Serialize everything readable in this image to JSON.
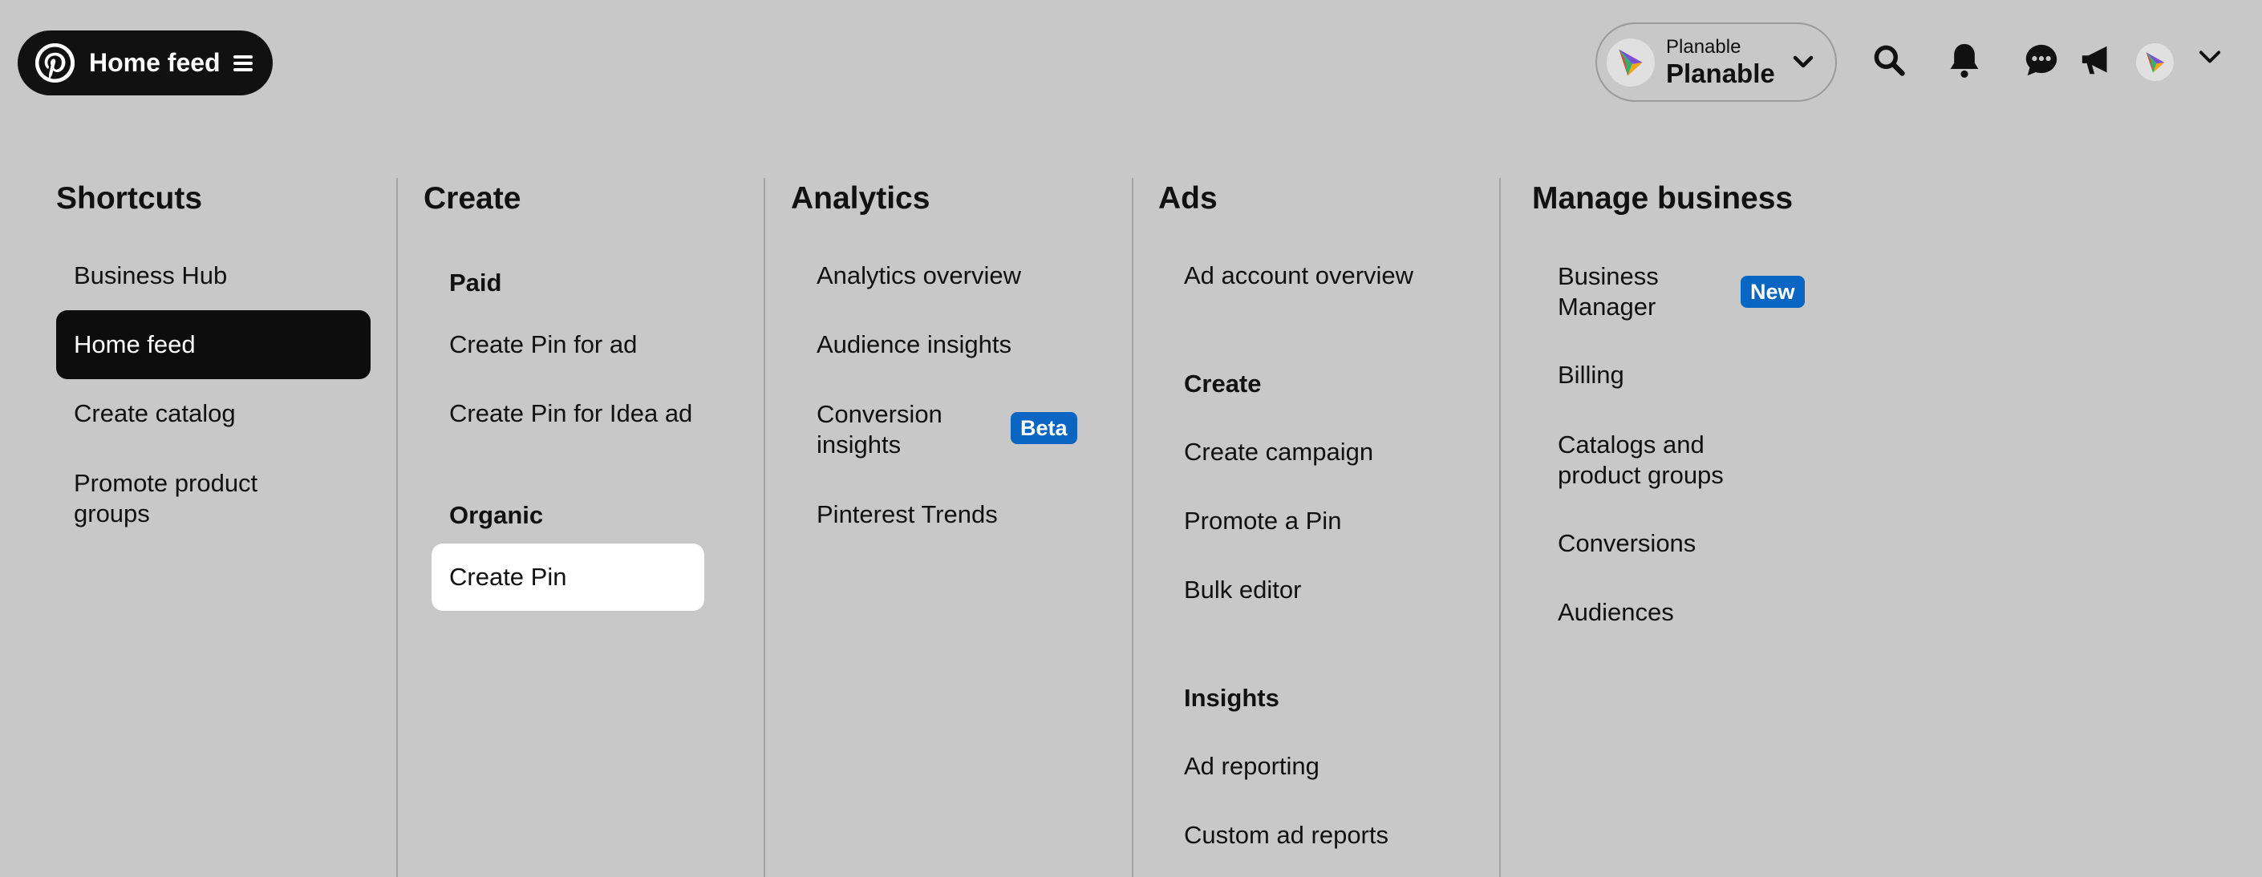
{
  "header": {
    "home_label": "Home feed",
    "account_small": "Planable",
    "account_big": "Planable",
    "icons": [
      "pinterest-logo-icon",
      "menu-icon",
      "planable-logo-icon",
      "chevron-down-icon",
      "search-icon",
      "bell-icon",
      "chat-icon",
      "megaphone-icon",
      "chevron-down-icon"
    ]
  },
  "shortcuts": {
    "title": "Shortcuts",
    "items": [
      "Business Hub",
      "Home feed",
      "Create catalog",
      "Promote product groups"
    ],
    "promote_line1": "Promote product",
    "promote_line2": "groups"
  },
  "create": {
    "title": "Create",
    "paid_heading": "Paid",
    "paid_items": [
      "Create Pin for ad",
      "Create Pin for Idea ad"
    ],
    "organic_heading": "Organic",
    "organic_items": [
      "Create Pin"
    ]
  },
  "analytics": {
    "title": "Analytics",
    "items": [
      "Analytics overview",
      "Audience insights",
      "Conversion insights",
      "Pinterest Trends"
    ],
    "conversion_line1": "Conversion",
    "conversion_line2": "insights",
    "conversion_badge": "Beta"
  },
  "ads": {
    "title": "Ads",
    "overview": "Ad account overview",
    "create_heading": "Create",
    "create_items": [
      "Create campaign",
      "Promote a Pin",
      "Bulk editor"
    ],
    "insights_heading": "Insights",
    "insights_items": [
      "Ad reporting",
      "Custom ad reports"
    ]
  },
  "manage": {
    "title": "Manage business",
    "business_manager_line1": "Business",
    "business_manager_line2": "Manager",
    "business_manager_badge": "New",
    "items": [
      "Billing",
      "Catalogs and product groups",
      "Conversions",
      "Audiences"
    ],
    "catalogs_line1": "Catalogs and",
    "catalogs_line2": "product groups"
  },
  "colors": {
    "background": "#c8c8c8",
    "active_item": "#0d0d0d",
    "badge": "#0a66c2",
    "hover_item": "#ffffff"
  }
}
